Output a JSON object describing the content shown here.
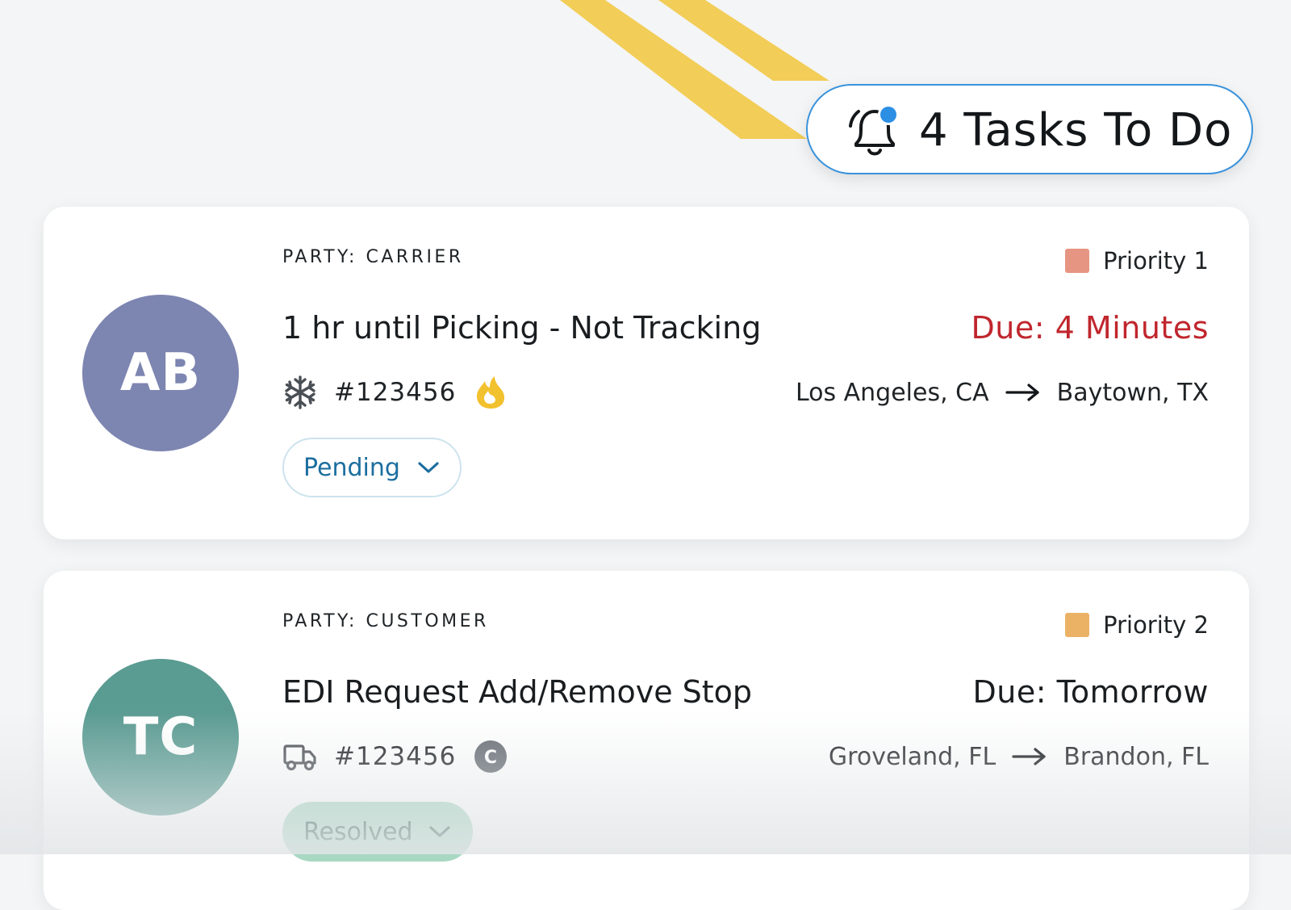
{
  "header": {
    "tasks_label": "4 Tasks To Do",
    "bell_icon": "bell-notification-icon",
    "accent_color": "#3a93dc",
    "stripe_color": "#f2cd57"
  },
  "tasks": [
    {
      "avatar_initials": "AB",
      "avatar_color": "#7d85b1",
      "party": "PARTY: CARRIER",
      "title": "1 hr until Picking - Not Tracking",
      "mode_icon": "snowflake-icon",
      "load_id": "#123456",
      "badge_icon": "flame-icon",
      "status": "Pending",
      "priority_label": "Priority 1",
      "priority_color": "#e69582",
      "due": "Due: 4 Minutes",
      "due_color": "#c0262d",
      "origin": "Los Angeles, CA",
      "destination": "Baytown, TX"
    },
    {
      "avatar_initials": "TC",
      "avatar_color": "#5a9b92",
      "party": "PARTY: CUSTOMER",
      "title": "EDI Request Add/Remove Stop",
      "mode_icon": "truck-icon",
      "load_id": "#123456",
      "badge_icon": "c-badge-icon",
      "badge_text": "C",
      "status": "Resolved",
      "priority_label": "Priority 2",
      "priority_color": "#ebb266",
      "due": "Due: Tomorrow",
      "due_color": "#1a1d20",
      "origin": "Groveland, FL",
      "destination": "Brandon, FL"
    }
  ]
}
